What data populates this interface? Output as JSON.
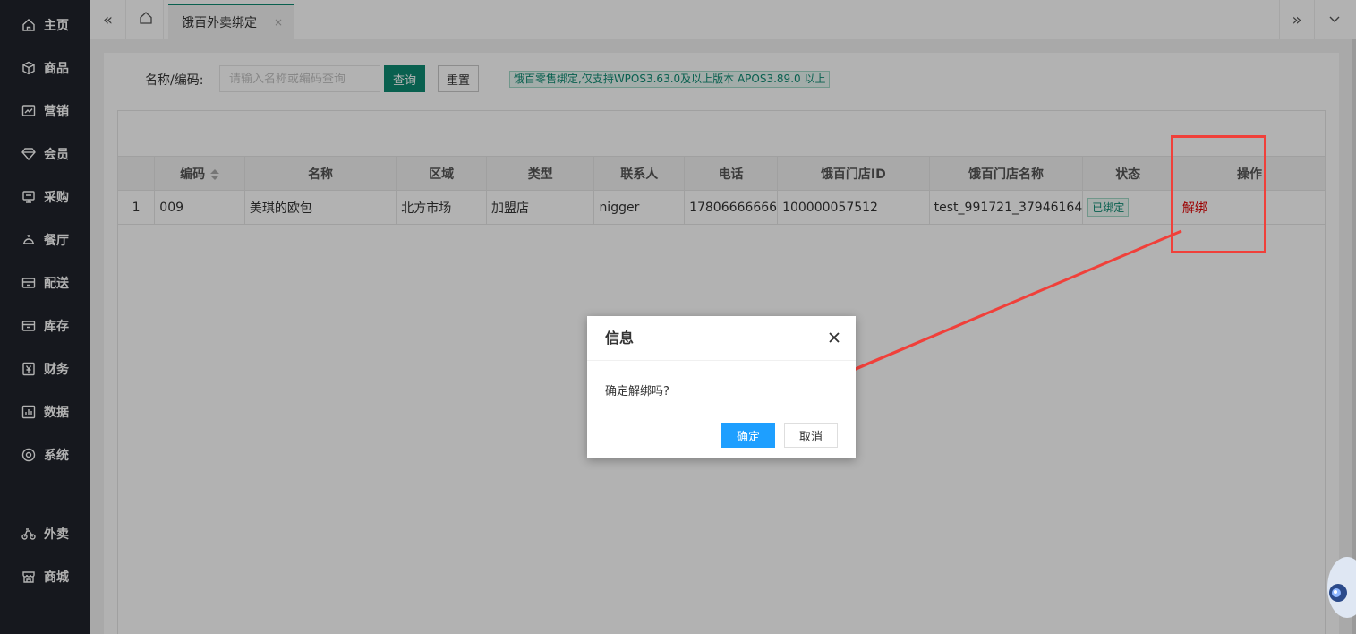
{
  "sidebar": {
    "items": [
      {
        "label": "主页",
        "icon": "home-icon"
      },
      {
        "label": "商品",
        "icon": "box-icon"
      },
      {
        "label": "营销",
        "icon": "trend-chart-icon"
      },
      {
        "label": "会员",
        "icon": "diamond-icon"
      },
      {
        "label": "采购",
        "icon": "purchase-screen-icon"
      },
      {
        "label": "餐厅",
        "icon": "service-bell-icon"
      },
      {
        "label": "配送",
        "icon": "delivery-icon"
      },
      {
        "label": "库存",
        "icon": "warehouse-icon"
      },
      {
        "label": "财务",
        "icon": "yen-icon"
      },
      {
        "label": "数据",
        "icon": "bar-chart-icon"
      },
      {
        "label": "系统",
        "icon": "settings-icon"
      },
      {
        "label": "外卖",
        "icon": "bike-icon"
      },
      {
        "label": "商城",
        "icon": "store-icon"
      }
    ]
  },
  "tabs": {
    "active_label": "饿百外卖绑定",
    "close_glyph": "×"
  },
  "search": {
    "label": "名称/编码:",
    "placeholder": "请输入名称或编码查询",
    "query_button": "查询",
    "reset_button": "重置",
    "notice": "饿百零售绑定,仅支持WPOS3.63.0及以上版本 APOS3.89.0 以上"
  },
  "table": {
    "headers": [
      "",
      "编码",
      "名称",
      "区域",
      "类型",
      "联系人",
      "电话",
      "饿百门店ID",
      "饿百门店名称",
      "状态",
      "操作"
    ],
    "rows": [
      {
        "index": "1",
        "code": "009",
        "name": "美琪的欧包",
        "region": "北方市场",
        "type": "加盟店",
        "contact": "nigger",
        "phone": "17806666666",
        "store_id": "100000057512",
        "store_name": "test_991721_37946164",
        "status": "已绑定",
        "action": "解绑"
      }
    ]
  },
  "dialog": {
    "title": "信息",
    "message": "确定解绑吗?",
    "ok_label": "确定",
    "cancel_label": "取消"
  },
  "colors": {
    "sidebar_bg": "#20232b",
    "accent": "#0e8a72",
    "primary_button": "#1e9fff",
    "danger": "#e00000",
    "highlight": "#f0403a"
  }
}
